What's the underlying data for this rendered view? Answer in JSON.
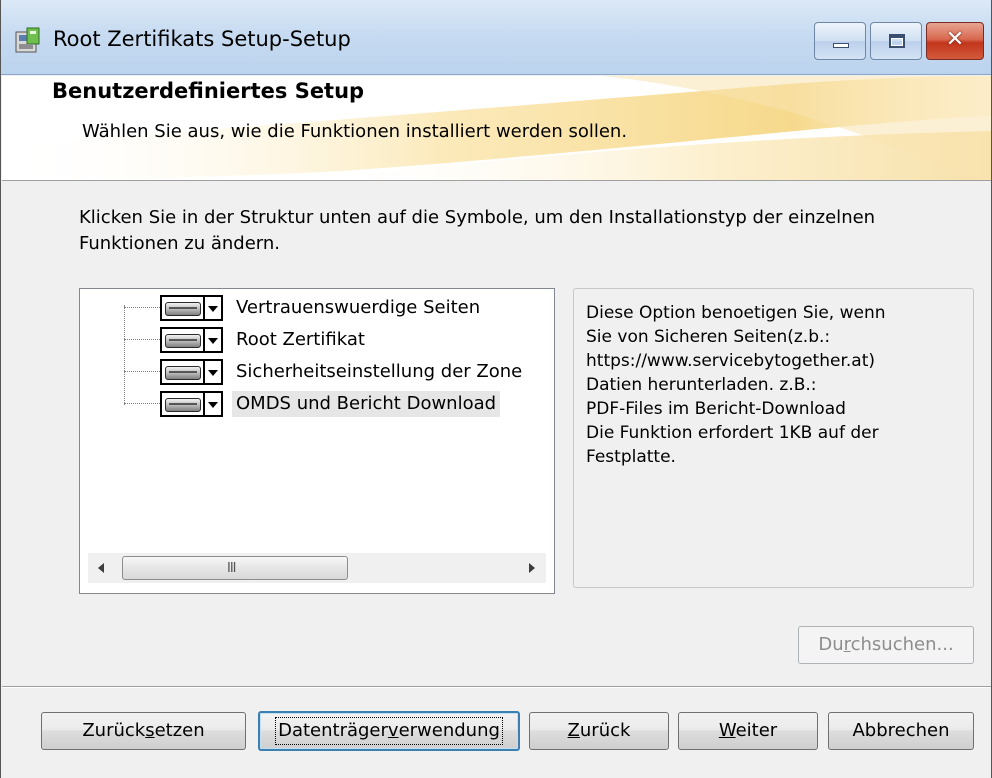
{
  "window": {
    "title": "Root Zertifikats Setup-Setup",
    "close_glyph": "✕",
    "controls": [
      "minimize-icon",
      "maximize-icon",
      "close-icon"
    ]
  },
  "banner": {
    "title": "Benutzerdefiniertes Setup",
    "subtitle": "Wählen Sie aus, wie die Funktionen installiert werden sollen."
  },
  "instruction": "Klicken Sie in der Struktur unten auf die Symbole, um den Installationstyp der einzelnen Funktionen zu ändern.",
  "feature_tree": {
    "items": [
      {
        "label": "Vertrauenswuerdige Seiten",
        "icon": "hard-drive-icon",
        "selected": false
      },
      {
        "label": "Root Zertifikat",
        "icon": "hard-drive-icon",
        "selected": false
      },
      {
        "label": "Sicherheitseinstellung der Zone",
        "icon": "hard-drive-icon",
        "selected": false
      },
      {
        "label": "OMDS und Bericht Download",
        "icon": "hard-drive-icon",
        "selected": true
      }
    ],
    "scrollbar_grip": "III"
  },
  "description": "Diese Option benoetigen Sie, wenn\nSie von Sicheren Seiten(z.b.:\nhttps://www.servicebytogether.at)\nDatien herunterladen. z.B.:\nPDF-Files im Bericht-Download\nDie Funktion erfordert 1KB auf der\nFestplatte.",
  "buttons": {
    "browse": {
      "pre": "Du",
      "accel": "r",
      "post": "chsuchen...",
      "enabled": false
    },
    "reset": {
      "pre": "Zurück",
      "accel": "s",
      "post": "etzen"
    },
    "disk_usage": {
      "pre": "Datenträger",
      "accel": "v",
      "post": "erwendung"
    },
    "back": {
      "pre": "",
      "accel": "Z",
      "post": "urück"
    },
    "next": {
      "pre": "",
      "accel": "W",
      "post": "eiter"
    },
    "cancel": {
      "pre": "Abbrechen",
      "accel": "",
      "post": ""
    }
  },
  "colors": {
    "title_bar": "#c7dbf1",
    "close_button": "#c2361c",
    "focus_border": "#3c7fb1",
    "banner_swoosh": "#f6d98c"
  }
}
